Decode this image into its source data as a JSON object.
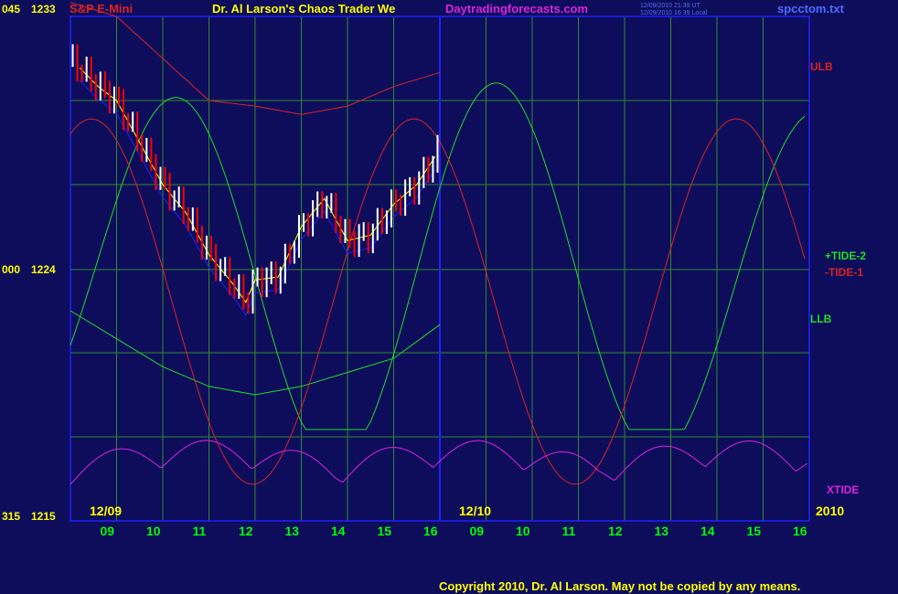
{
  "colors": {
    "background": "#0d0d5c",
    "grid": "#2e8b2e",
    "frame": "#2020ff",
    "price": "#ffffff",
    "price_down": "#ff0000",
    "ma_fast": "#ffff00",
    "ma_slow": "#2020ff",
    "band": "#dd2222",
    "tide_plus": "#22dd22",
    "tide_minus": "#dd2222",
    "xtide": "#dd22dd",
    "axis_text": "#ffff00",
    "day_text": "#00ff00"
  },
  "header": {
    "left_scale": "045",
    "left_price": "1233",
    "symbol": "S&P E-Mini",
    "title": "Dr. Al Larson's Chaos Trader We",
    "site": "Daytradingforecasts.com",
    "stamp_ut": "12/09/2010 21:39 UT",
    "stamp_local": "12/09/2010 16:39 Local",
    "file": "spcctom.txt"
  },
  "axis": {
    "mid_scale": "000",
    "mid_price": "1224",
    "bottom_scale": "315",
    "bottom_price": "1215",
    "date_left": "12/09",
    "date_mid": "12/10",
    "year": "2010",
    "hour_labels": [
      "09",
      "10",
      "11",
      "12",
      "13",
      "14",
      "15",
      "16",
      "09",
      "10",
      "11",
      "12",
      "13",
      "14",
      "15",
      "16"
    ]
  },
  "labels": {
    "ulb": "ULB",
    "tide2": "+TIDE-2",
    "tide1": "-TIDE-1",
    "llb": "LLB",
    "xtide": "XTIDE"
  },
  "footer": {
    "copyright": "Copyright 2010, Dr. Al Larson. May not be copied by any means."
  },
  "chart_data": {
    "type": "line",
    "title": "S&P E-Mini",
    "y_price_range": [
      1215,
      1233
    ],
    "x": [
      "12/09 08:00",
      "09",
      "10",
      "11",
      "12",
      "13",
      "14",
      "15",
      "16",
      "12/10 08:00",
      "09",
      "10",
      "11",
      "12",
      "13",
      "14",
      "15",
      "16"
    ],
    "series": [
      {
        "name": "price",
        "x_hours": [
          8.0,
          8.3,
          8.6,
          9.0,
          9.5,
          10.0,
          10.5,
          11.0,
          11.5,
          11.8,
          12.0,
          12.5,
          13.0,
          13.5,
          14.0,
          14.5,
          15.0,
          15.5,
          15.9
        ],
        "values": [
          1231.5,
          1231.0,
          1230.5,
          1230.0,
          1228.5,
          1227.0,
          1226.0,
          1224.5,
          1223.5,
          1222.8,
          1223.6,
          1223.7,
          1225.5,
          1226.5,
          1225.0,
          1225.2,
          1226.3,
          1227.0,
          1228.0
        ]
      },
      {
        "name": "ULB",
        "values": [
          1233.5,
          1233.0,
          1231.5,
          1230.0,
          1229.8,
          1229.5,
          1229.8,
          1230.5,
          1231.0
        ]
      },
      {
        "name": "LLB",
        "values": [
          1222.5,
          1221.5,
          1220.5,
          1219.8,
          1219.5,
          1219.8,
          1220.3,
          1220.8,
          1222.0
        ]
      },
      {
        "name": "+TIDE-2"
      },
      {
        "name": "-TIDE-1"
      },
      {
        "name": "XTIDE"
      }
    ],
    "grid": true,
    "legend": "right"
  }
}
